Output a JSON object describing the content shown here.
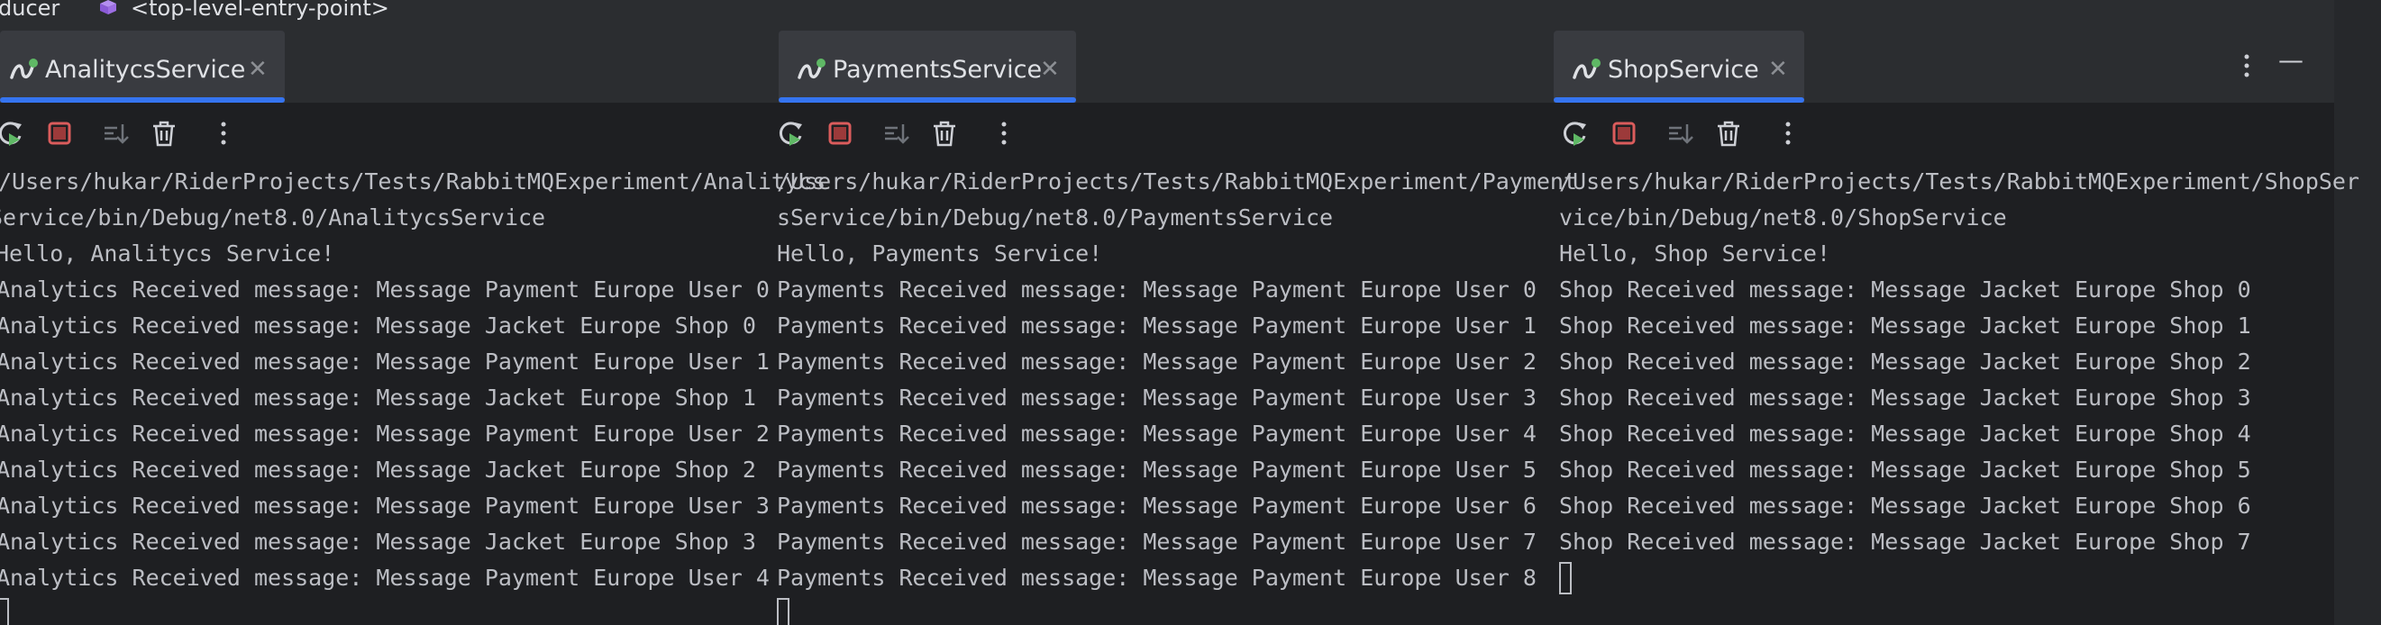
{
  "topbar": {
    "left_fragment": "ducer",
    "entry_point": "<top-level-entry-point>",
    "cube_color": "#a571e6"
  },
  "colors": {
    "accent": "#3574f0",
    "stop_red": "#db5c5c",
    "rerun_green": "#5fb865"
  },
  "panes": [
    {
      "tab_label": "AnalitycsService",
      "tab_close": "✕",
      "lines": [
        "/Users/hukar/RiderProjects/Tests/RabbitMQExperiment/Analitycs",
        "Service/bin/Debug/net8.0/AnalitycsService",
        "Hello, Analitycs Service!",
        "Analytics Received message: Message Payment Europe User 0",
        "Analytics Received message: Message Jacket Europe Shop 0",
        "Analytics Received message: Message Payment Europe User 1",
        "Analytics Received message: Message Jacket Europe Shop 1",
        "Analytics Received message: Message Payment Europe User 2",
        "Analytics Received message: Message Jacket Europe Shop 2",
        "Analytics Received message: Message Payment Europe User 3",
        "Analytics Received message: Message Jacket Europe Shop 3",
        "Analytics Received message: Message Payment Europe User 4"
      ]
    },
    {
      "tab_label": "PaymentsService",
      "tab_close": "✕",
      "lines": [
        "/Users/hukar/RiderProjects/Tests/RabbitMQExperiment/Payment",
        "sService/bin/Debug/net8.0/PaymentsService",
        "Hello, Payments Service!",
        "Payments Received message: Message Payment Europe User 0",
        "Payments Received message: Message Payment Europe User 1",
        "Payments Received message: Message Payment Europe User 2",
        "Payments Received message: Message Payment Europe User 3",
        "Payments Received message: Message Payment Europe User 4",
        "Payments Received message: Message Payment Europe User 5",
        "Payments Received message: Message Payment Europe User 6",
        "Payments Received message: Message Payment Europe User 7",
        "Payments Received message: Message Payment Europe User 8"
      ]
    },
    {
      "tab_label": "ShopService",
      "tab_close": "✕",
      "lines": [
        "/Users/hukar/RiderProjects/Tests/RabbitMQExperiment/ShopSer",
        "vice/bin/Debug/net8.0/ShopService",
        "Hello, Shop Service!",
        "Shop Received message: Message Jacket Europe Shop 0",
        "Shop Received message: Message Jacket Europe Shop 1",
        "Shop Received message: Message Jacket Europe Shop 2",
        "Shop Received message: Message Jacket Europe Shop 3",
        "Shop Received message: Message Jacket Europe Shop 4",
        "Shop Received message: Message Jacket Europe Shop 5",
        "Shop Received message: Message Jacket Europe Shop 6",
        "Shop Received message: Message Jacket Europe Shop 7"
      ]
    }
  ],
  "window_controls": {
    "minimize": "—"
  }
}
